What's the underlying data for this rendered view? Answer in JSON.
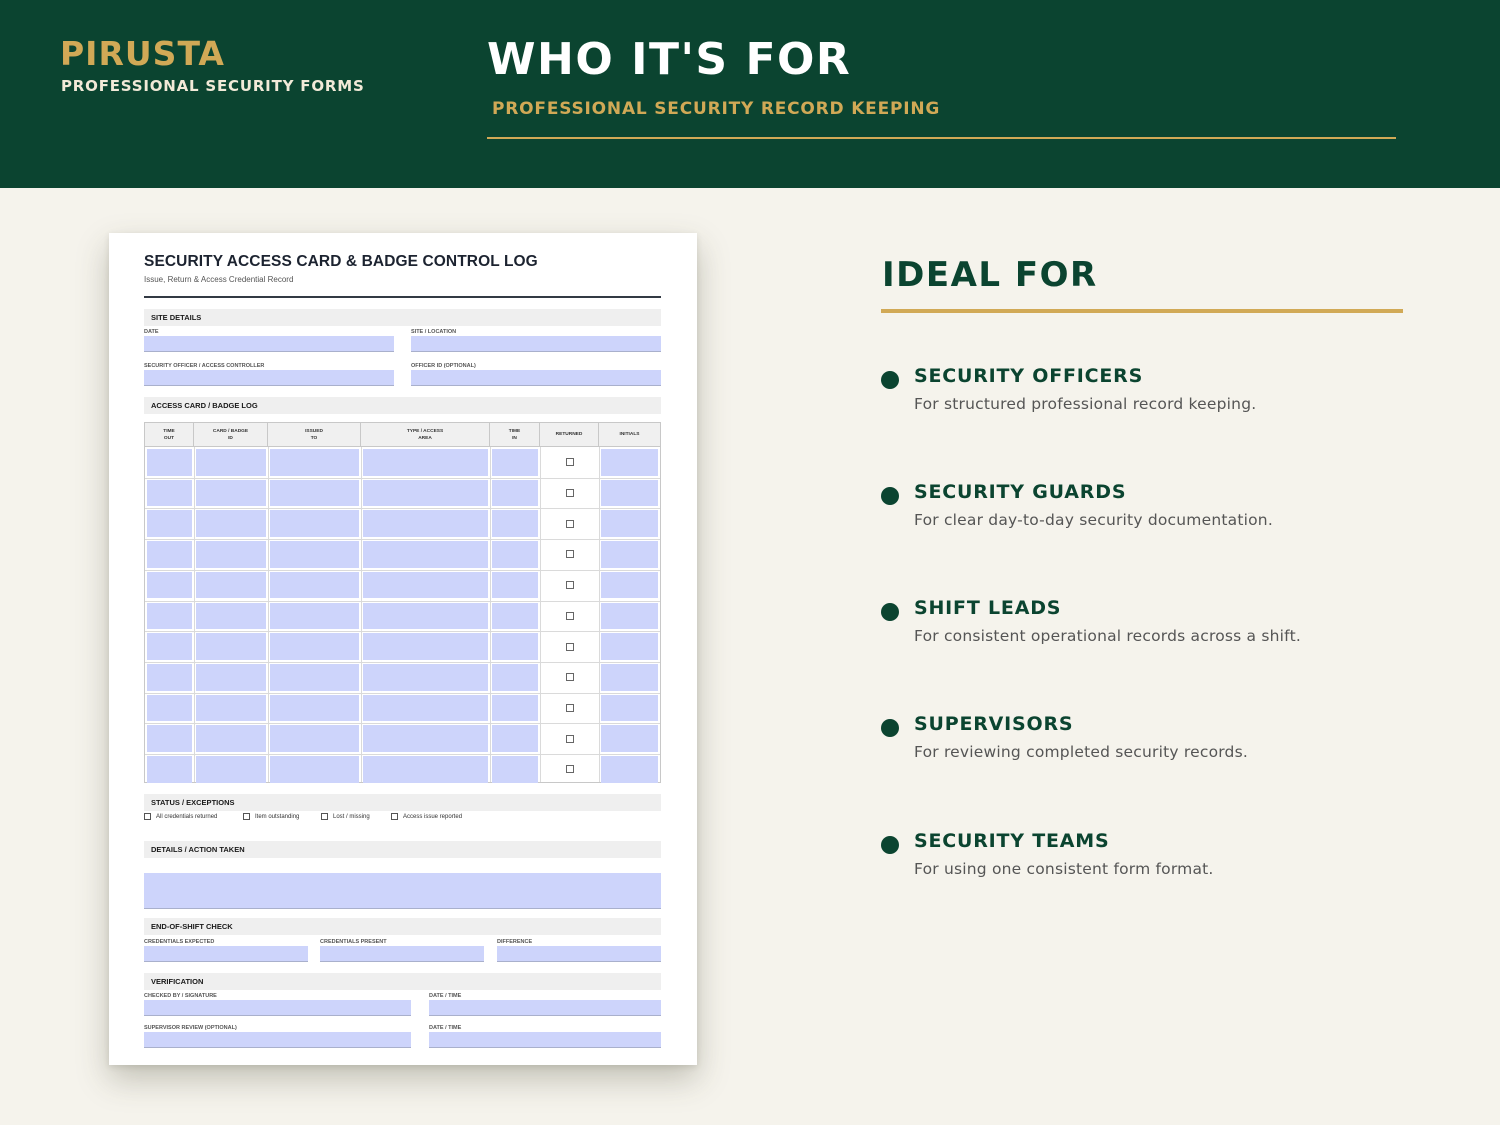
{
  "header": {
    "brand": "PIRUSTA",
    "brand_sub": "PROFESSIONAL SECURITY FORMS",
    "title": "WHO IT'S FOR",
    "subtitle": "PROFESSIONAL SECURITY RECORD KEEPING"
  },
  "form": {
    "title": "SECURITY ACCESS CARD & BADGE CONTROL LOG",
    "subtitle": "Issue, Return & Access Credential Record",
    "site_details": {
      "heading": "SITE DETAILS",
      "date": "DATE",
      "site_location": "SITE / LOCATION",
      "officer": "SECURITY OFFICER / ACCESS CONTROLLER",
      "officer_id": "OFFICER ID (OPTIONAL)"
    },
    "log": {
      "heading": "ACCESS CARD / BADGE LOG",
      "columns": [
        "TIME\nOUT",
        "CARD / BADGE\nID",
        "ISSUED\nTO",
        "TYPE / ACCESS\nAREA",
        "TIME\nIN",
        "RETURNED",
        "INITIALS"
      ],
      "row_count": 11
    },
    "status": {
      "heading": "STATUS / EXCEPTIONS",
      "options": [
        "All credentials returned",
        "Item outstanding",
        "Lost / missing",
        "Access issue reported"
      ]
    },
    "details": {
      "heading": "DETAILS / ACTION TAKEN"
    },
    "end_of_shift": {
      "heading": "END-OF-SHIFT CHECK",
      "expected": "CREDENTIALS EXPECTED",
      "present": "CREDENTIALS PRESENT",
      "difference": "DIFFERENCE"
    },
    "verification": {
      "heading": "VERIFICATION",
      "checked_by": "CHECKED BY / SIGNATURE",
      "date_time_1": "DATE / TIME",
      "supervisor": "SUPERVISOR REVIEW (OPTIONAL)",
      "date_time_2": "DATE / TIME"
    }
  },
  "ideal": {
    "title": "IDEAL FOR",
    "items": [
      {
        "title": "SECURITY OFFICERS",
        "desc": "For structured professional record keeping."
      },
      {
        "title": "SECURITY GUARDS",
        "desc": "For clear day-to-day security documentation."
      },
      {
        "title": "SHIFT LEADS",
        "desc": "For consistent operational records across a shift."
      },
      {
        "title": "SUPERVISORS",
        "desc": "For reviewing completed security records."
      },
      {
        "title": "SECURITY TEAMS",
        "desc": "For using one consistent form format."
      }
    ]
  },
  "colors": {
    "primary": "#0b4430",
    "accent": "#d1a956",
    "background": "#f5f3ec",
    "field_fill": "#cdd4fb"
  }
}
